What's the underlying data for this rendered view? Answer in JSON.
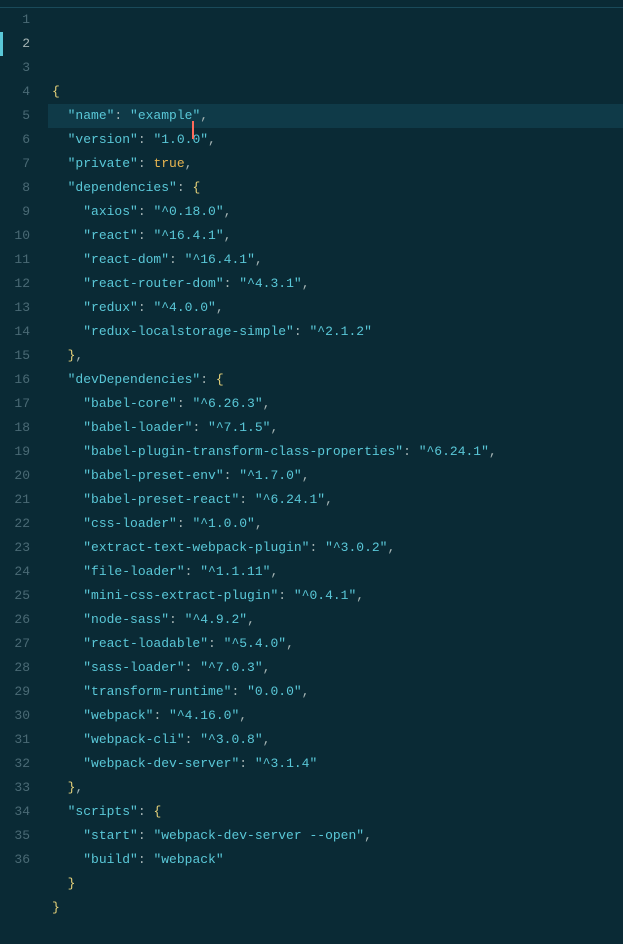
{
  "editor": {
    "active_line": 2,
    "cursor_line": 2,
    "line_count": 36
  },
  "content": {
    "name": "example",
    "version": "1.0.0",
    "private": true,
    "dependencies": {
      "axios": "^0.18.0",
      "react": "^16.4.1",
      "react-dom": "^16.4.1",
      "react-router-dom": "^4.3.1",
      "redux": "^4.0.0",
      "redux-localstorage-simple": "^2.1.2"
    },
    "devDependencies": {
      "babel-core": "^6.26.3",
      "babel-loader": "^7.1.5",
      "babel-plugin-transform-class-properties": "^6.24.1",
      "babel-preset-env": "^1.7.0",
      "babel-preset-react": "^6.24.1",
      "css-loader": "^1.0.0",
      "extract-text-webpack-plugin": "^3.0.2",
      "file-loader": "^1.1.11",
      "mini-css-extract-plugin": "^0.4.1",
      "node-sass": "^4.9.2",
      "react-loadable": "^5.4.0",
      "sass-loader": "^7.0.3",
      "transform-runtime": "0.0.0",
      "webpack": "^4.16.0",
      "webpack-cli": "^3.0.8",
      "webpack-dev-server": "^3.1.4"
    },
    "scripts": {
      "start": "webpack-dev-server --open",
      "build": "webpack"
    }
  },
  "tokens": [
    [
      {
        "t": "brace",
        "v": "{"
      }
    ],
    [
      {
        "t": "ind",
        "v": "  "
      },
      {
        "t": "key",
        "v": "\"name\""
      },
      {
        "t": "colon",
        "v": ": "
      },
      {
        "t": "strcur",
        "v": "\"example",
        "after": "\""
      },
      {
        "t": "punc",
        "v": ","
      }
    ],
    [
      {
        "t": "ind",
        "v": "  "
      },
      {
        "t": "key",
        "v": "\"version\""
      },
      {
        "t": "colon",
        "v": ": "
      },
      {
        "t": "str",
        "v": "\"1.0.0\""
      },
      {
        "t": "punc",
        "v": ","
      }
    ],
    [
      {
        "t": "ind",
        "v": "  "
      },
      {
        "t": "key",
        "v": "\"private\""
      },
      {
        "t": "colon",
        "v": ": "
      },
      {
        "t": "bool",
        "v": "true"
      },
      {
        "t": "punc",
        "v": ","
      }
    ],
    [
      {
        "t": "ind",
        "v": "  "
      },
      {
        "t": "key",
        "v": "\"dependencies\""
      },
      {
        "t": "colon",
        "v": ": "
      },
      {
        "t": "brace",
        "v": "{"
      }
    ],
    [
      {
        "t": "ind",
        "v": "    "
      },
      {
        "t": "key",
        "v": "\"axios\""
      },
      {
        "t": "colon",
        "v": ": "
      },
      {
        "t": "str",
        "v": "\"^0.18.0\""
      },
      {
        "t": "punc",
        "v": ","
      }
    ],
    [
      {
        "t": "ind",
        "v": "    "
      },
      {
        "t": "key",
        "v": "\"react\""
      },
      {
        "t": "colon",
        "v": ": "
      },
      {
        "t": "str",
        "v": "\"^16.4.1\""
      },
      {
        "t": "punc",
        "v": ","
      }
    ],
    [
      {
        "t": "ind",
        "v": "    "
      },
      {
        "t": "key",
        "v": "\"react-dom\""
      },
      {
        "t": "colon",
        "v": ": "
      },
      {
        "t": "str",
        "v": "\"^16.4.1\""
      },
      {
        "t": "punc",
        "v": ","
      }
    ],
    [
      {
        "t": "ind",
        "v": "    "
      },
      {
        "t": "key",
        "v": "\"react-router-dom\""
      },
      {
        "t": "colon",
        "v": ": "
      },
      {
        "t": "str",
        "v": "\"^4.3.1\""
      },
      {
        "t": "punc",
        "v": ","
      }
    ],
    [
      {
        "t": "ind",
        "v": "    "
      },
      {
        "t": "key",
        "v": "\"redux\""
      },
      {
        "t": "colon",
        "v": ": "
      },
      {
        "t": "str",
        "v": "\"^4.0.0\""
      },
      {
        "t": "punc",
        "v": ","
      }
    ],
    [
      {
        "t": "ind",
        "v": "    "
      },
      {
        "t": "key",
        "v": "\"redux-localstorage-simple\""
      },
      {
        "t": "colon",
        "v": ": "
      },
      {
        "t": "str",
        "v": "\"^2.1.2\""
      }
    ],
    [
      {
        "t": "ind",
        "v": "  "
      },
      {
        "t": "brace",
        "v": "}"
      },
      {
        "t": "punc",
        "v": ","
      }
    ],
    [
      {
        "t": "ind",
        "v": "  "
      },
      {
        "t": "key",
        "v": "\"devDependencies\""
      },
      {
        "t": "colon",
        "v": ": "
      },
      {
        "t": "brace",
        "v": "{"
      }
    ],
    [
      {
        "t": "ind",
        "v": "    "
      },
      {
        "t": "key",
        "v": "\"babel-core\""
      },
      {
        "t": "colon",
        "v": ": "
      },
      {
        "t": "str",
        "v": "\"^6.26.3\""
      },
      {
        "t": "punc",
        "v": ","
      }
    ],
    [
      {
        "t": "ind",
        "v": "    "
      },
      {
        "t": "key",
        "v": "\"babel-loader\""
      },
      {
        "t": "colon",
        "v": ": "
      },
      {
        "t": "str",
        "v": "\"^7.1.5\""
      },
      {
        "t": "punc",
        "v": ","
      }
    ],
    [
      {
        "t": "ind",
        "v": "    "
      },
      {
        "t": "key",
        "v": "\"babel-plugin-transform-class-properties\""
      },
      {
        "t": "colon",
        "v": ": "
      },
      {
        "t": "str",
        "v": "\"^6.24.1\""
      },
      {
        "t": "punc",
        "v": ","
      }
    ],
    [
      {
        "t": "ind",
        "v": "    "
      },
      {
        "t": "key",
        "v": "\"babel-preset-env\""
      },
      {
        "t": "colon",
        "v": ": "
      },
      {
        "t": "str",
        "v": "\"^1.7.0\""
      },
      {
        "t": "punc",
        "v": ","
      }
    ],
    [
      {
        "t": "ind",
        "v": "    "
      },
      {
        "t": "key",
        "v": "\"babel-preset-react\""
      },
      {
        "t": "colon",
        "v": ": "
      },
      {
        "t": "str",
        "v": "\"^6.24.1\""
      },
      {
        "t": "punc",
        "v": ","
      }
    ],
    [
      {
        "t": "ind",
        "v": "    "
      },
      {
        "t": "key",
        "v": "\"css-loader\""
      },
      {
        "t": "colon",
        "v": ": "
      },
      {
        "t": "str",
        "v": "\"^1.0.0\""
      },
      {
        "t": "punc",
        "v": ","
      }
    ],
    [
      {
        "t": "ind",
        "v": "    "
      },
      {
        "t": "key",
        "v": "\"extract-text-webpack-plugin\""
      },
      {
        "t": "colon",
        "v": ": "
      },
      {
        "t": "str",
        "v": "\"^3.0.2\""
      },
      {
        "t": "punc",
        "v": ","
      }
    ],
    [
      {
        "t": "ind",
        "v": "    "
      },
      {
        "t": "key",
        "v": "\"file-loader\""
      },
      {
        "t": "colon",
        "v": ": "
      },
      {
        "t": "str",
        "v": "\"^1.1.11\""
      },
      {
        "t": "punc",
        "v": ","
      }
    ],
    [
      {
        "t": "ind",
        "v": "    "
      },
      {
        "t": "key",
        "v": "\"mini-css-extract-plugin\""
      },
      {
        "t": "colon",
        "v": ": "
      },
      {
        "t": "str",
        "v": "\"^0.4.1\""
      },
      {
        "t": "punc",
        "v": ","
      }
    ],
    [
      {
        "t": "ind",
        "v": "    "
      },
      {
        "t": "key",
        "v": "\"node-sass\""
      },
      {
        "t": "colon",
        "v": ": "
      },
      {
        "t": "str",
        "v": "\"^4.9.2\""
      },
      {
        "t": "punc",
        "v": ","
      }
    ],
    [
      {
        "t": "ind",
        "v": "    "
      },
      {
        "t": "key",
        "v": "\"react-loadable\""
      },
      {
        "t": "colon",
        "v": ": "
      },
      {
        "t": "str",
        "v": "\"^5.4.0\""
      },
      {
        "t": "punc",
        "v": ","
      }
    ],
    [
      {
        "t": "ind",
        "v": "    "
      },
      {
        "t": "key",
        "v": "\"sass-loader\""
      },
      {
        "t": "colon",
        "v": ": "
      },
      {
        "t": "str",
        "v": "\"^7.0.3\""
      },
      {
        "t": "punc",
        "v": ","
      }
    ],
    [
      {
        "t": "ind",
        "v": "    "
      },
      {
        "t": "key",
        "v": "\"transform-runtime\""
      },
      {
        "t": "colon",
        "v": ": "
      },
      {
        "t": "str",
        "v": "\"0.0.0\""
      },
      {
        "t": "punc",
        "v": ","
      }
    ],
    [
      {
        "t": "ind",
        "v": "    "
      },
      {
        "t": "key",
        "v": "\"webpack\""
      },
      {
        "t": "colon",
        "v": ": "
      },
      {
        "t": "str",
        "v": "\"^4.16.0\""
      },
      {
        "t": "punc",
        "v": ","
      }
    ],
    [
      {
        "t": "ind",
        "v": "    "
      },
      {
        "t": "key",
        "v": "\"webpack-cli\""
      },
      {
        "t": "colon",
        "v": ": "
      },
      {
        "t": "str",
        "v": "\"^3.0.8\""
      },
      {
        "t": "punc",
        "v": ","
      }
    ],
    [
      {
        "t": "ind",
        "v": "    "
      },
      {
        "t": "key",
        "v": "\"webpack-dev-server\""
      },
      {
        "t": "colon",
        "v": ": "
      },
      {
        "t": "str",
        "v": "\"^3.1.4\""
      }
    ],
    [
      {
        "t": "ind",
        "v": "  "
      },
      {
        "t": "brace",
        "v": "}"
      },
      {
        "t": "punc",
        "v": ","
      }
    ],
    [
      {
        "t": "ind",
        "v": "  "
      },
      {
        "t": "key",
        "v": "\"scripts\""
      },
      {
        "t": "colon",
        "v": ": "
      },
      {
        "t": "brace",
        "v": "{"
      }
    ],
    [
      {
        "t": "ind",
        "v": "    "
      },
      {
        "t": "key",
        "v": "\"start\""
      },
      {
        "t": "colon",
        "v": ": "
      },
      {
        "t": "str",
        "v": "\"webpack-dev-server --open\""
      },
      {
        "t": "punc",
        "v": ","
      }
    ],
    [
      {
        "t": "ind",
        "v": "    "
      },
      {
        "t": "key",
        "v": "\"build\""
      },
      {
        "t": "colon",
        "v": ": "
      },
      {
        "t": "str",
        "v": "\"webpack\""
      }
    ],
    [
      {
        "t": "ind",
        "v": "  "
      },
      {
        "t": "brace",
        "v": "}"
      }
    ],
    [
      {
        "t": "brace",
        "v": "}"
      }
    ],
    []
  ]
}
